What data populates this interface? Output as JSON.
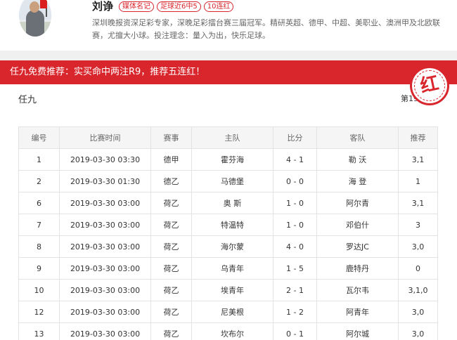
{
  "expert": {
    "name": "刘诤",
    "tags": [
      "媒体名记",
      "足球近6中5",
      "10连红"
    ],
    "description": "深圳晚报资深足彩专家，深晚足彩擂台赛三届冠军。精研英超、德甲、中超、美职业、澳洲甲及北欧联赛，尤擅大小球。投注理念：量入为出，快乐足球。"
  },
  "titlebar": {
    "title": "任九免费推荐：实买命中两注R9，推荐五连红！"
  },
  "stamp": {
    "char": "红"
  },
  "lottery": {
    "type": "任九",
    "issue": "第19042期"
  },
  "table": {
    "headers": [
      "编号",
      "比赛时间",
      "赛事",
      "主队",
      "比分",
      "客队",
      "推荐"
    ],
    "rows": [
      [
        "1",
        "2019-03-30 03:30",
        "德甲",
        "霍芬海",
        "4 - 1",
        "勒 沃",
        "3,1"
      ],
      [
        "2",
        "2019-03-30 01:30",
        "德乙",
        "马德堡",
        "0 - 0",
        "海 登",
        "1"
      ],
      [
        "6",
        "2019-03-30 03:00",
        "荷乙",
        "奥 斯",
        "1 - 0",
        "阿尔青",
        "3,1"
      ],
      [
        "7",
        "2019-03-30 03:00",
        "荷乙",
        "特温特",
        "1 - 0",
        "邓伯什",
        "3"
      ],
      [
        "8",
        "2019-03-30 03:00",
        "荷乙",
        "海尔蒙",
        "4 - 0",
        "罗达JC",
        "3,0"
      ],
      [
        "9",
        "2019-03-30 03:00",
        "荷乙",
        "乌青年",
        "1 - 5",
        "鹿特丹",
        "0"
      ],
      [
        "10",
        "2019-03-30 03:00",
        "荷乙",
        "埃青年",
        "2 - 1",
        "瓦尔韦",
        "3,1,0"
      ],
      [
        "12",
        "2019-03-30 03:00",
        "荷乙",
        "尼美根",
        "1 - 2",
        "阿青年",
        "3,0"
      ],
      [
        "13",
        "2019-03-30 03:00",
        "荷乙",
        "坎布尔",
        "0 - 1",
        "阿尔城",
        "3,0"
      ]
    ]
  },
  "colors": {
    "accent": "#d8262c",
    "page_bg": "#f0f0f0"
  }
}
